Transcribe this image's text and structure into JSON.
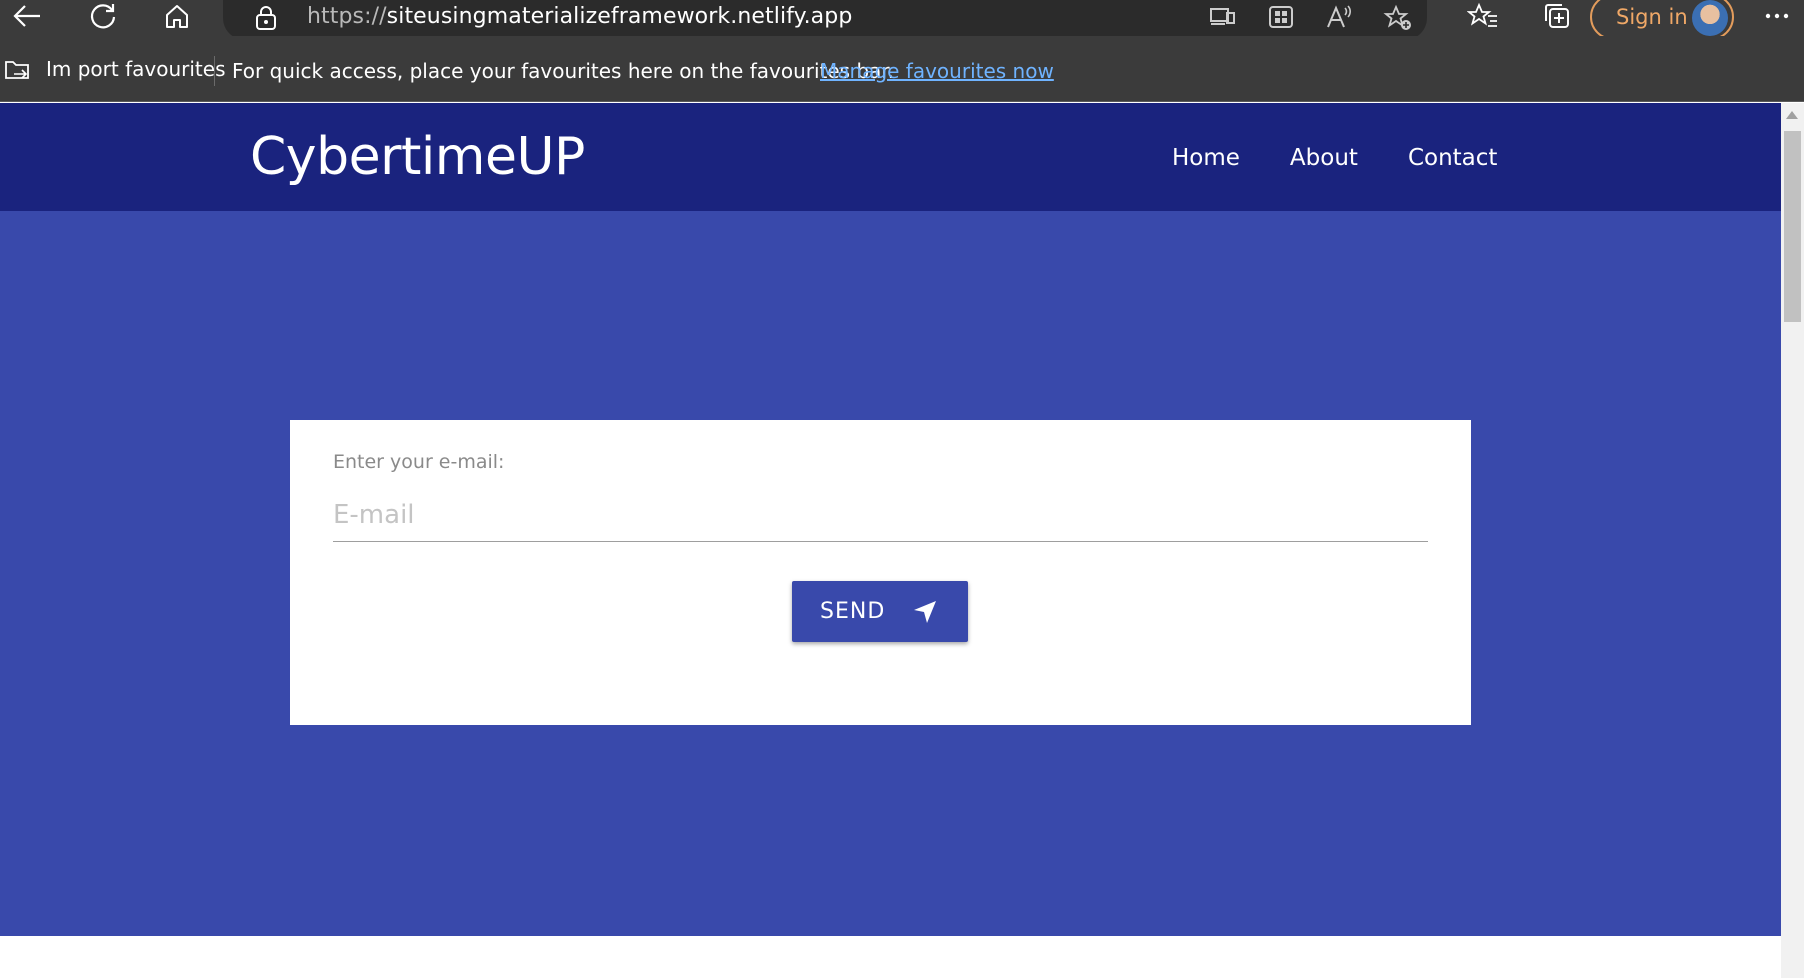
{
  "browser": {
    "url_protocol": "https://",
    "url_host": "siteusingmaterializeframework.netlify.app",
    "sign_in_label": "Sign in",
    "icons": [
      "back-arrow-icon",
      "refresh-icon",
      "home-icon",
      "lock-icon",
      "device-icon",
      "apps-grid-icon",
      "read-aloud-icon",
      "add-favourite-icon",
      "favourites-icon",
      "collections-icon",
      "more-icon"
    ]
  },
  "favourites_bar": {
    "import_label": "Im port favourites",
    "message": "For quick access, place your favourites here on the favourites bar.",
    "manage_link": "Manage favourites now"
  },
  "navbar": {
    "brand": "CybertimeUP",
    "links": [
      "Home",
      "About",
      "Contact"
    ]
  },
  "form": {
    "label": "Enter your e-mail:",
    "placeholder": "E-mail",
    "value": "",
    "send_label": "SEND"
  },
  "colors": {
    "navbar_bg": "#1a237e",
    "hero_bg": "#3949ab",
    "button_bg": "#3949ab",
    "browser_chrome": "#3b3b3b",
    "link": "#6fb3ff",
    "sign_in_accent": "#f0a867"
  }
}
